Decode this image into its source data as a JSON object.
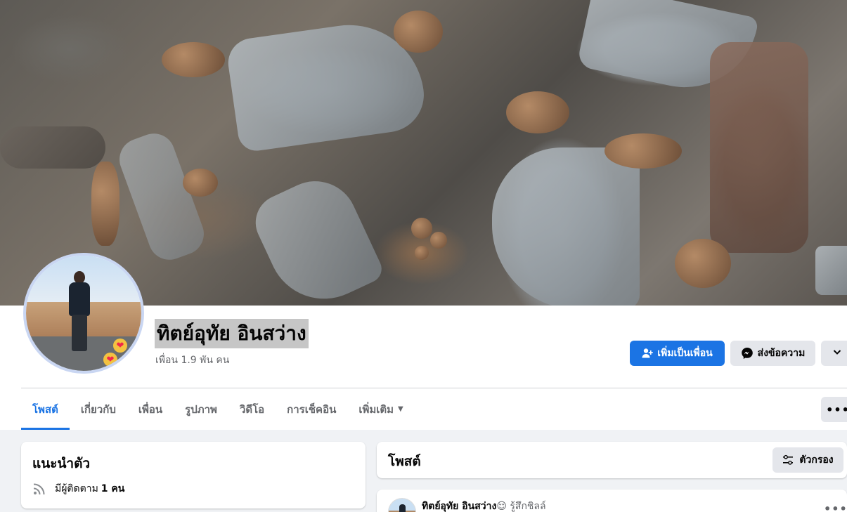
{
  "profile": {
    "name": "ทิตย์อุทัย อินสว่าง",
    "friends": "เพื่อน 1.9 พัน คน"
  },
  "actions": {
    "add_friend": "เพิ่มเป็นเพื่อน",
    "message": "ส่งข้อความ",
    "more_icon": "chevron-down-icon"
  },
  "tabs": [
    {
      "label": "โพสต์"
    },
    {
      "label": "เกี่ยวกับ"
    },
    {
      "label": "เพื่อน"
    },
    {
      "label": "รูปภาพ"
    },
    {
      "label": "วิดีโอ"
    },
    {
      "label": "การเช็คอิน"
    },
    {
      "label": "เพิ่มเติม"
    }
  ],
  "intro": {
    "title": "แนะนำตัว",
    "followers_prefix": "มีผู้ติดตาม",
    "followers_count": "1 คน"
  },
  "posts": {
    "title": "โพสต์",
    "filter": "ตัวกรอง"
  },
  "post": {
    "author": "ทิตย์อุทัย อินสว่าง",
    "feeling": "😌 รู้สึกชิลล์"
  },
  "colors": {
    "primary": "#1b74e4",
    "secondary_button": "#e4e6eb",
    "page_bg": "#f0f2f5"
  }
}
